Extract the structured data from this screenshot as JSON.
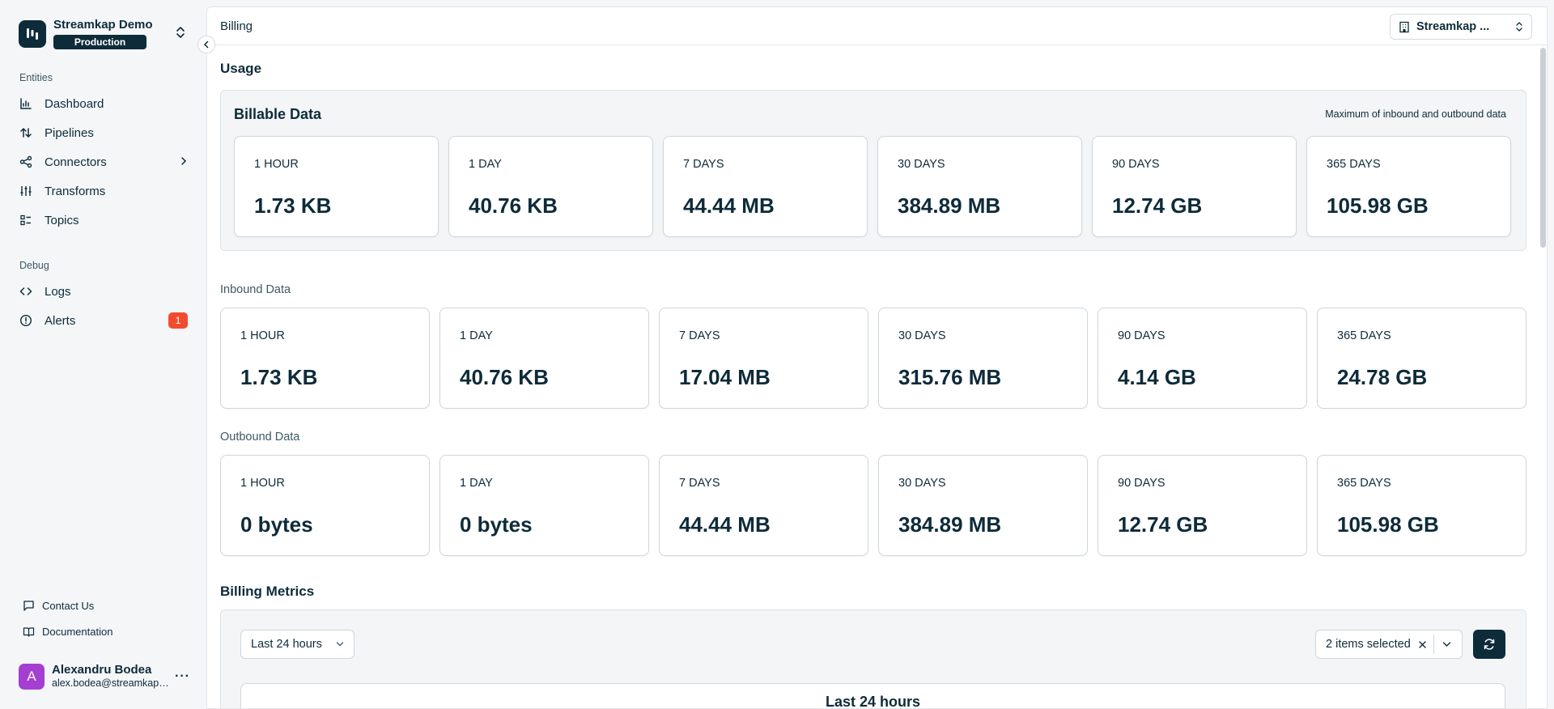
{
  "sidebar": {
    "org_name": "Streamkap Demo",
    "environment": "Production",
    "sections": {
      "entities": "Entities",
      "debug": "Debug"
    },
    "entities": [
      {
        "label": "Dashboard",
        "icon": "bar-chart-icon"
      },
      {
        "label": "Pipelines",
        "icon": "arrows-up-down-icon"
      },
      {
        "label": "Connectors",
        "icon": "share-nodes-icon"
      },
      {
        "label": "Transforms",
        "icon": "sliders-icon"
      },
      {
        "label": "Topics",
        "icon": "list-icon"
      }
    ],
    "debug": [
      {
        "label": "Logs",
        "icon": "code-icon"
      },
      {
        "label": "Alerts",
        "icon": "alert-circle-icon",
        "badge": "1"
      }
    ],
    "footer_links": [
      {
        "label": "Contact Us",
        "icon": "chat-icon"
      },
      {
        "label": "Documentation",
        "icon": "book-icon"
      }
    ],
    "user": {
      "initial": "A",
      "name": "Alexandru Bodea",
      "email": "alex.bodea@streamkap.com"
    }
  },
  "topbar": {
    "breadcrumb": "Billing",
    "org_selector": "Streamkap ..."
  },
  "usage": {
    "title": "Usage",
    "billable": {
      "title": "Billable Data",
      "note": "Maximum of inbound and outbound data",
      "cards": [
        {
          "label": "1 HOUR",
          "value": "1.73 KB"
        },
        {
          "label": "1 DAY",
          "value": "40.76 KB"
        },
        {
          "label": "7 DAYS",
          "value": "44.44 MB"
        },
        {
          "label": "30 DAYS",
          "value": "384.89 MB"
        },
        {
          "label": "90 DAYS",
          "value": "12.74 GB"
        },
        {
          "label": "365 DAYS",
          "value": "105.98 GB"
        }
      ]
    },
    "inbound": {
      "title": "Inbound Data",
      "cards": [
        {
          "label": "1 HOUR",
          "value": "1.73 KB"
        },
        {
          "label": "1 DAY",
          "value": "40.76 KB"
        },
        {
          "label": "7 DAYS",
          "value": "17.04 MB"
        },
        {
          "label": "30 DAYS",
          "value": "315.76 MB"
        },
        {
          "label": "90 DAYS",
          "value": "4.14 GB"
        },
        {
          "label": "365 DAYS",
          "value": "24.78 GB"
        }
      ]
    },
    "outbound": {
      "title": "Outbound Data",
      "cards": [
        {
          "label": "1 HOUR",
          "value": "0 bytes"
        },
        {
          "label": "1 DAY",
          "value": "0 bytes"
        },
        {
          "label": "7 DAYS",
          "value": "44.44 MB"
        },
        {
          "label": "30 DAYS",
          "value": "384.89 MB"
        },
        {
          "label": "90 DAYS",
          "value": "12.74 GB"
        },
        {
          "label": "365 DAYS",
          "value": "105.98 GB"
        }
      ]
    }
  },
  "metrics": {
    "title": "Billing Metrics",
    "range": "Last 24 hours",
    "selection": "2 items selected",
    "chart_title": "Last 24 hours"
  },
  "colors": {
    "brand_dark": "#0e2b3a",
    "badge": "#f24c2e",
    "avatar": "#a43fd1"
  }
}
